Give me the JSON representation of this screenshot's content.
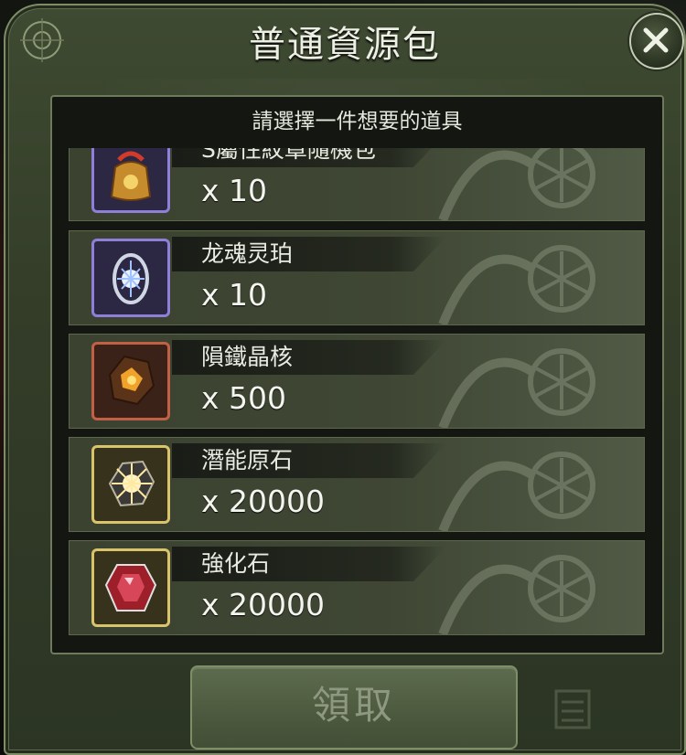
{
  "dialog": {
    "title": "普通資源包",
    "subtitle": "請選擇一件想要的道具",
    "close_icon": "close-x-icon",
    "claim_label": "領取"
  },
  "items": [
    {
      "name": "S屬性紋章隨機包",
      "quantity": "x 10",
      "icon": "gift-bag-icon",
      "frame_color": "#8e7fd9"
    },
    {
      "name": "龙魂灵珀",
      "quantity": "x 10",
      "icon": "dragon-soul-amber-icon",
      "frame_color": "#8e7fd9"
    },
    {
      "name": "隕鐵晶核",
      "quantity": "x 500",
      "icon": "meteorite-crystal-core-icon",
      "frame_color": "#c26045"
    },
    {
      "name": "潛能原石",
      "quantity": "x 20000",
      "icon": "potential-ore-icon",
      "frame_color": "#d9c46b"
    },
    {
      "name": "強化石",
      "quantity": "x 20000",
      "icon": "enhancement-stone-icon",
      "frame_color": "#d9c46b"
    }
  ],
  "colors": {
    "frame_green": "#3f4a32",
    "panel_dark": "#141612",
    "row_green": "#3f4734",
    "text_light": "#e8ebe1",
    "button_disabled_text": "#8e977f"
  }
}
